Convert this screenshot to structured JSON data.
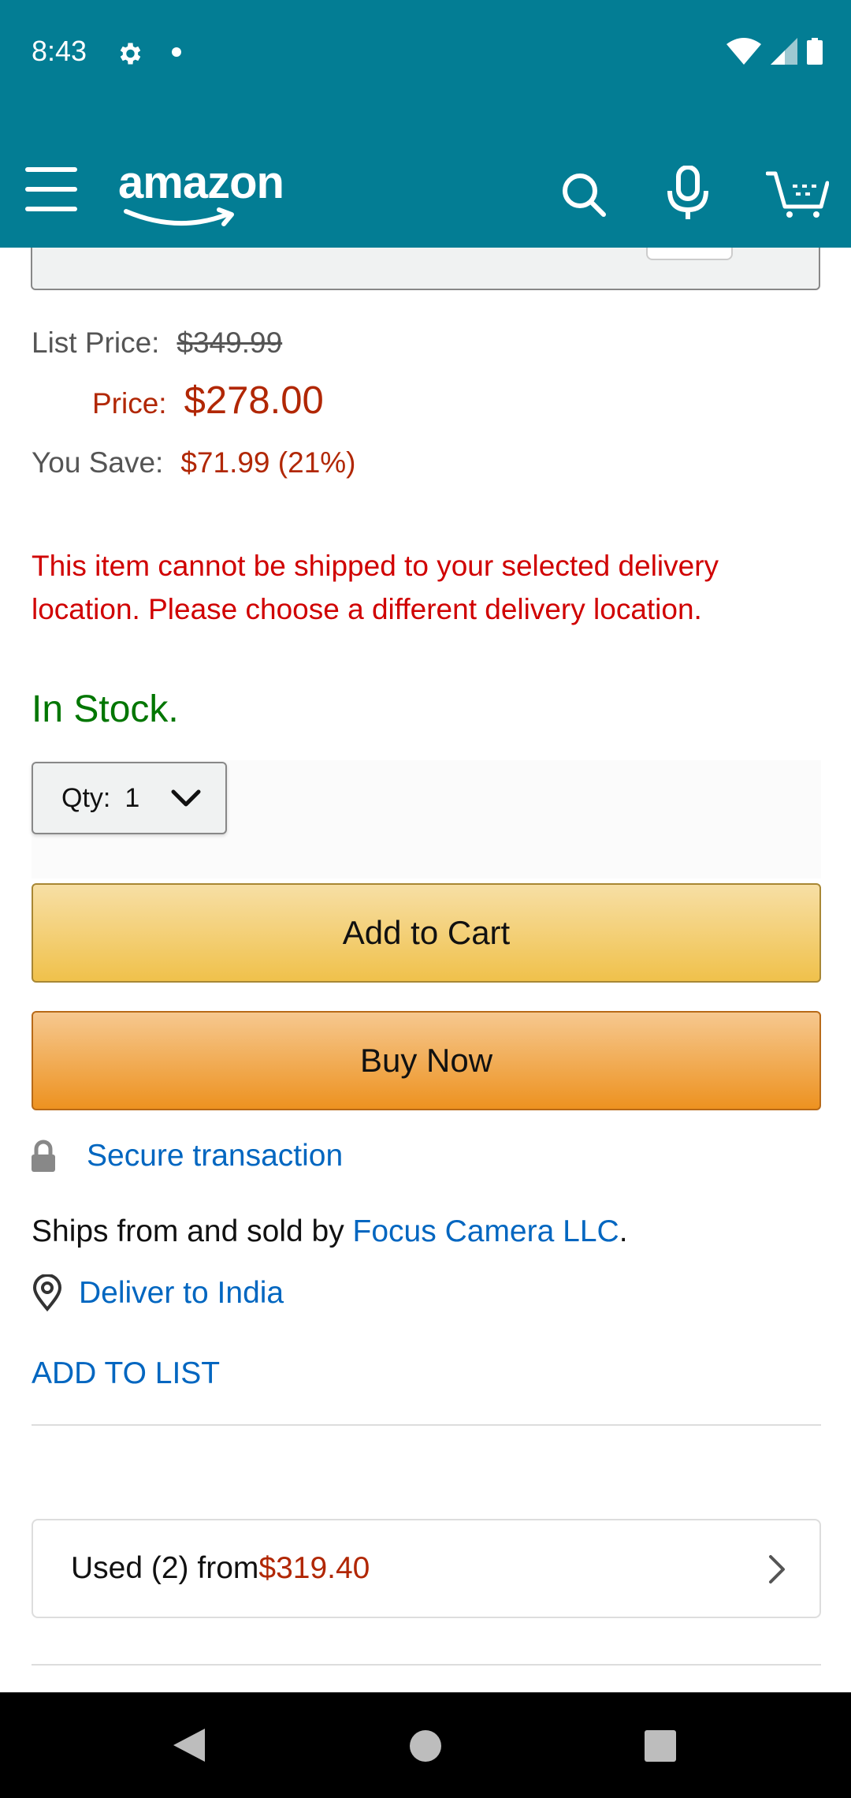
{
  "status_bar": {
    "time": "8:43"
  },
  "header": {
    "logo_text": "amazon",
    "brand_color": "#037d94"
  },
  "pricing": {
    "list_price_label": "List Price:",
    "list_price": "$349.99",
    "price_label": "Price:",
    "price": "$278.00",
    "you_save_label": "You Save:",
    "you_save": "$71.99 (21%)"
  },
  "delivery_warning": "This item cannot be shipped to your selected delivery location. Please choose a different delivery location.",
  "stock_status": "In Stock.",
  "quantity": {
    "label": "Qty:",
    "value": "1"
  },
  "buttons": {
    "add_to_cart": "Add to Cart",
    "buy_now": "Buy Now",
    "add_to_list": "ADD TO LIST"
  },
  "secure": {
    "text": "Secure transaction"
  },
  "seller": {
    "prefix": "Ships from and sold by ",
    "name": "Focus Camera LLC",
    "suffix": "."
  },
  "deliver_to": "Deliver to India",
  "used_offer": {
    "prefix": "Used (2) from ",
    "price": "$319.40"
  },
  "colors": {
    "price_red": "#b12704",
    "warning_red": "#d00000",
    "in_stock_green": "#007600",
    "link_blue": "#0066c0"
  }
}
